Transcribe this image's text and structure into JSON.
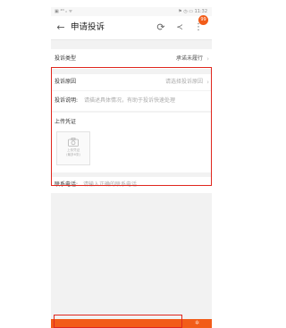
{
  "status_bar": {
    "left": "▣ ⁴ᴳ ᵢₗ ᯤ",
    "right": "⚑ ◷ ▭ 11:32"
  },
  "header": {
    "back_icon": "←",
    "title": "申请投诉",
    "refresh_icon": "⟳",
    "share_icon": "≺",
    "more_icon": "⋮",
    "badge": "99"
  },
  "form": {
    "complaint_type": {
      "label": "投诉类型",
      "value": "承诺未履行",
      "chevron": "›"
    },
    "complaint_reason": {
      "label": "投诉原因",
      "placeholder": "请选择投诉原因",
      "chevron": "›"
    },
    "complaint_desc": {
      "label": "投诉说明:",
      "placeholder": "请描述具体情况，有助于投诉快速处理"
    },
    "upload": {
      "label": "上传凭证",
      "box_line1": "上传凭证",
      "box_line2": "(最多6张)"
    },
    "contact_phone": {
      "label": "联系电话:",
      "placeholder": "请输入正确的联系电话"
    }
  },
  "bottom_bar": {
    "icon": "✲"
  },
  "colors": {
    "accent": "#f25c19",
    "highlight": "#e0271e"
  }
}
